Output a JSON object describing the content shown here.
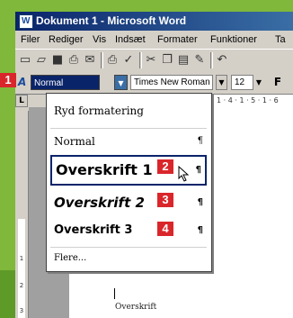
{
  "window": {
    "title": "Dokument 1 - Microsoft Word",
    "app_icon": "W"
  },
  "menu": [
    "Filer",
    "Rediger",
    "Vis",
    "Indsæt",
    "Formater",
    "Funktioner",
    "Ta"
  ],
  "toolbar_icons": [
    "new-document-icon",
    "open-folder-icon",
    "save-icon",
    "print-icon",
    "email-icon",
    "print-preview-icon",
    "spell-check-icon",
    "cut-icon",
    "copy-icon",
    "paste-icon",
    "format-painter-icon",
    "undo-icon"
  ],
  "format_bar": {
    "style_value": "Normal",
    "font_value": "Times New Roman",
    "size_value": "12",
    "bold_label": "F"
  },
  "ruler": {
    "corner_label": "L",
    "h_ticks": "1 · 4 · 1 · 5 · 1 · 6",
    "v_ticks": [
      "1",
      "2",
      "3"
    ]
  },
  "dropdown": {
    "items": [
      {
        "label": "Ryd formatering",
        "mark": ""
      },
      {
        "label": "Normal",
        "mark": "¶"
      },
      {
        "label": "Overskrift 1",
        "mark": "¶"
      },
      {
        "label": "Overskrift 2",
        "mark": "¶"
      },
      {
        "label": "Overskrift 3",
        "mark": "¶"
      },
      {
        "label": "Flere...",
        "mark": ""
      }
    ]
  },
  "badges": [
    "1",
    "2",
    "3",
    "4"
  ],
  "document": {
    "text": "Overskrift"
  },
  "colors": {
    "accent": "#d9262b",
    "title_bar": "#0a246a",
    "background": "#7fb83a"
  }
}
